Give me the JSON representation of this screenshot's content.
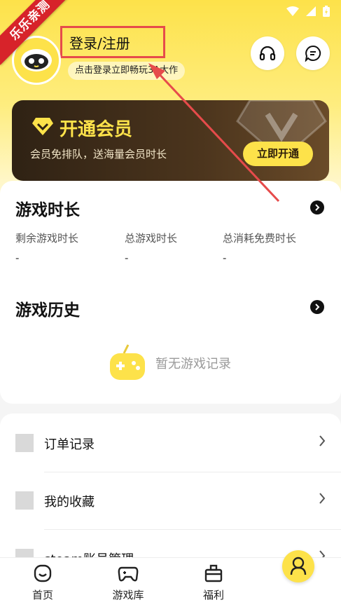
{
  "ribbon": {
    "text": "乐乐亲测"
  },
  "header": {
    "login_label": "登录/注册",
    "subtitle": "点击登录立即畅玩3A大作"
  },
  "vip": {
    "title": "开通会员",
    "subtitle": "会员免排队，送海量会员时长",
    "button": "立即开通"
  },
  "playtime": {
    "title": "游戏时长",
    "stats": [
      {
        "label": "剩余游戏时长",
        "value": "-"
      },
      {
        "label": "总游戏时长",
        "value": "-"
      },
      {
        "label": "总消耗免费时长",
        "value": "-"
      }
    ]
  },
  "history": {
    "title": "游戏历史",
    "empty": "暂无游戏记录"
  },
  "menu": [
    {
      "label": "订单记录"
    },
    {
      "label": "我的收藏"
    },
    {
      "label": "steam账号管理"
    }
  ],
  "tabs": [
    {
      "label": "首页",
      "icon": "home-icon"
    },
    {
      "label": "游戏库",
      "icon": "gamepad-icon"
    },
    {
      "label": "福利",
      "icon": "gift-icon"
    }
  ],
  "colors": {
    "brand_yellow": "#fde24a",
    "annotation_red": "#e64b4b",
    "ribbon_red": "#d7232a"
  }
}
